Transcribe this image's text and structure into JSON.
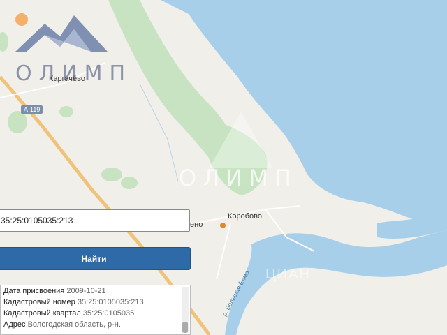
{
  "logo": {
    "text": "ОЛИМП",
    "icon": "mountain-logo-icon"
  },
  "watermark": {
    "text": "ОЛИМП",
    "text2": "ЦИАН"
  },
  "map": {
    "labels": {
      "kargachevo": "Каргачёво",
      "road": "А-119",
      "korobovo": "Коробово",
      "partial": "ено",
      "river": "р. Большая Ёлма"
    },
    "colors": {
      "water": "#a8cfe9",
      "forest": "#c7e3c1",
      "land": "#f1efe9",
      "road_major": "#f0c27a"
    }
  },
  "search": {
    "value": "35:25:0105035:213"
  },
  "find_button": {
    "label": "Найти"
  },
  "info": {
    "rows": [
      {
        "label": "Дата присвоения",
        "value": "2009-10-21"
      },
      {
        "label": "Кадастровый номер",
        "value": "35:25:0105035:213"
      },
      {
        "label": "Кадастровый квартал",
        "value": "35:25:0105035"
      },
      {
        "label": "Адрес",
        "value": "Вологодская область, р-н."
      }
    ]
  }
}
